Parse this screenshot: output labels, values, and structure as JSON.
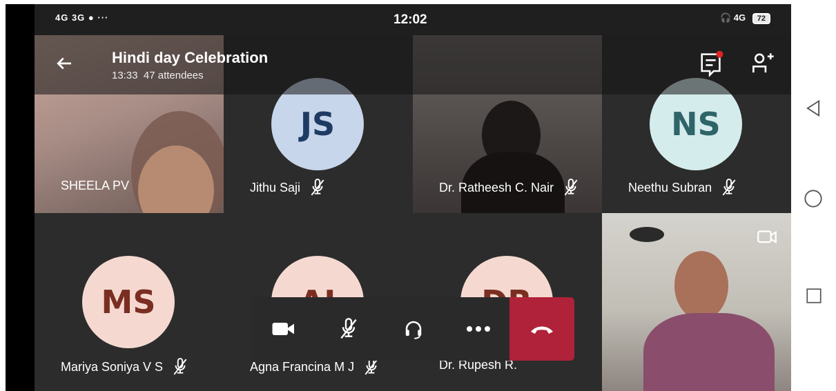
{
  "status_bar": {
    "signal_left": "4G 3G",
    "clock": "12:02",
    "network_right": "4G",
    "battery": "72"
  },
  "meeting": {
    "title": "Hindi day Celebration",
    "duration": "13:33",
    "attendees": "47 attendees"
  },
  "participants": [
    {
      "name": "SHEELA PV",
      "initials": ""
    },
    {
      "name": "Jithu Saji",
      "initials": "JS"
    },
    {
      "name": "Dr. Ratheesh C. Nair",
      "initials": ""
    },
    {
      "name": "Neethu Subran",
      "initials": "NS"
    },
    {
      "name": "Mariya Soniya V S",
      "initials": "MS"
    },
    {
      "name": "Agna Francina M J",
      "initials": "AJ"
    },
    {
      "name": "Dr. Rupesh R.",
      "initials": "DR"
    }
  ],
  "colors": {
    "avatar_js_bg": "#c7d6ea",
    "avatar_js_fg": "#1e3b63",
    "avatar_ns_bg": "#d5ecec",
    "avatar_ns_fg": "#2f6468",
    "avatar_ms_bg": "#f5d9d0",
    "avatar_ms_fg": "#7a2e22",
    "hangup": "#b0223a"
  }
}
